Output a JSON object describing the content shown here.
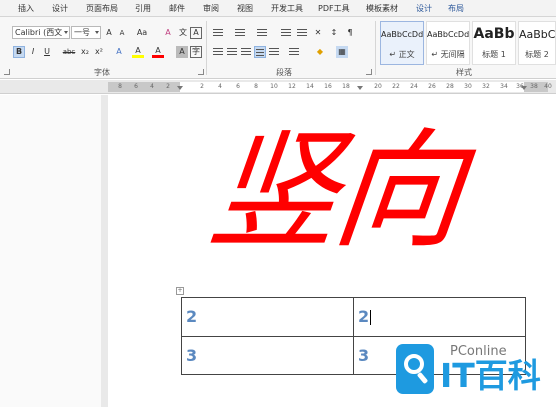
{
  "ribbon_tabs": [
    "插入",
    "设计",
    "页面布局",
    "引用",
    "邮件",
    "审阅",
    "视图",
    "开发工具",
    "PDF工具",
    "模板素材",
    "设计",
    "布局"
  ],
  "font_group": {
    "font_name": "Calibri (西文",
    "font_size": "一号",
    "label": "字体",
    "row1_buttons": [
      "A",
      "A",
      "Aa",
      "A",
      "文",
      "A"
    ],
    "row2_buttons": [
      "B",
      "I",
      "U",
      "abc",
      "x₂",
      "x²",
      "A",
      "A",
      "A",
      "A"
    ]
  },
  "paragraph_group": {
    "label": "段落"
  },
  "styles_group": {
    "label": "样式",
    "items": [
      {
        "sample": "AaBbCcDd",
        "name": "↵ 正文"
      },
      {
        "sample": "AaBbCcDd",
        "name": "↵ 无间隔"
      },
      {
        "sample": "AaBb",
        "name": "标题 1"
      },
      {
        "sample": "AaBbC",
        "name": "标题 2"
      }
    ]
  },
  "ruler_ticks": [
    "8",
    "6",
    "4",
    "2",
    "2",
    "4",
    "6",
    "8",
    "10",
    "12",
    "14",
    "16",
    "18",
    "20",
    "22",
    "24",
    "26",
    "28",
    "30",
    "32",
    "34",
    "36",
    "38",
    "40"
  ],
  "document": {
    "heading": "竖向",
    "table_handle": "+",
    "table": [
      [
        "2",
        "2"
      ],
      [
        "3",
        "3"
      ]
    ]
  },
  "watermark": {
    "top": "PConline",
    "bottom": "IT百科"
  },
  "colors": {
    "heading": "#ff0000",
    "table_text": "#5b89c0",
    "accent": "#2b579a",
    "watermark": "#1e9ae0"
  }
}
